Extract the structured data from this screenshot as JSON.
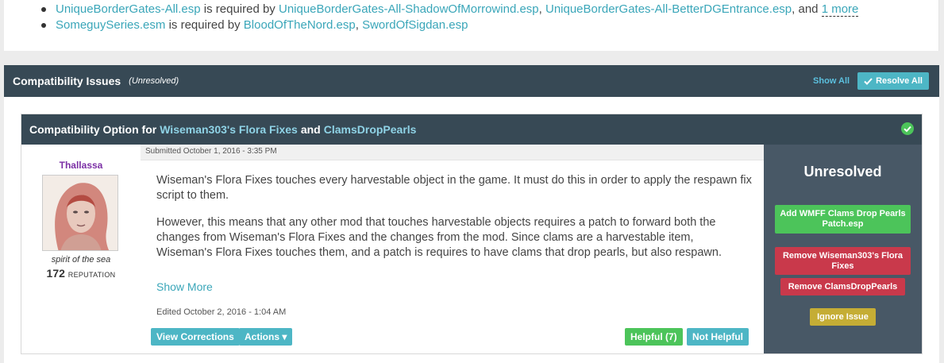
{
  "requirements": [
    {
      "plugin": "UniqueBorderGates-All.esp",
      "connector": "is required by",
      "dependents": [
        "UniqueBorderGates-All-ShadowOfMorrowind.esp",
        "UniqueBorderGates-All-BetterDGEntrance.esp"
      ],
      "and_text": ", and",
      "more_text": "1 more"
    },
    {
      "plugin": "SomeguySeries.esm",
      "connector": "is required by",
      "dependents": [
        "BloodOfTheNord.esp",
        "SwordOfSigdan.esp"
      ]
    }
  ],
  "issues": {
    "title": "Compatibility Issues",
    "status": "(Unresolved)",
    "show_all": "Show All",
    "resolve_all": "Resolve All"
  },
  "option": {
    "prefix": "Compatibility Option for",
    "mod_a": "Wiseman303's Flora Fixes",
    "joiner": "and",
    "mod_b": "ClamsDropPearls",
    "status_icon": "check-circle-icon"
  },
  "author": {
    "name": "Thallassa",
    "title": "spirit of the sea",
    "reputation": "172",
    "reputation_label": "REPUTATION"
  },
  "post": {
    "submitted": "Submitted October 1, 2016 - 3:35 PM",
    "paragraphs": [
      "Wiseman's Flora Fixes touches every harvestable object in the game. It must do this in order to apply the respawn fix script to them.",
      "However, this means that any other mod that touches harvestable objects requires a patch to forward both the changes from Wiseman's Flora Fixes and the changes from the mod. Since clams are a harvestable item, Wiseman's Flora Fixes touches them, and a patch is requires to have clams that drop pearls, but also respawn."
    ],
    "show_more": "Show More",
    "edited": "Edited October 2, 2016 - 1:04 AM",
    "view_corrections": "View Corrections",
    "actions": "Actions",
    "helpful": "Helpful (7)",
    "not_helpful": "Not Helpful"
  },
  "side": {
    "status": "Unresolved",
    "add_patch": "Add WMFF Clams Drop Pearls Patch.esp",
    "remove_a": "Remove Wiseman303's Flora Fixes",
    "remove_b": "Remove ClamsDropPearls",
    "ignore": "Ignore Issue"
  },
  "colors": {
    "header": "#374955",
    "side": "#485866",
    "link": "#3aa6b9",
    "green": "#4cc45a",
    "red": "#c9394b",
    "yellow": "#c5ad35"
  }
}
